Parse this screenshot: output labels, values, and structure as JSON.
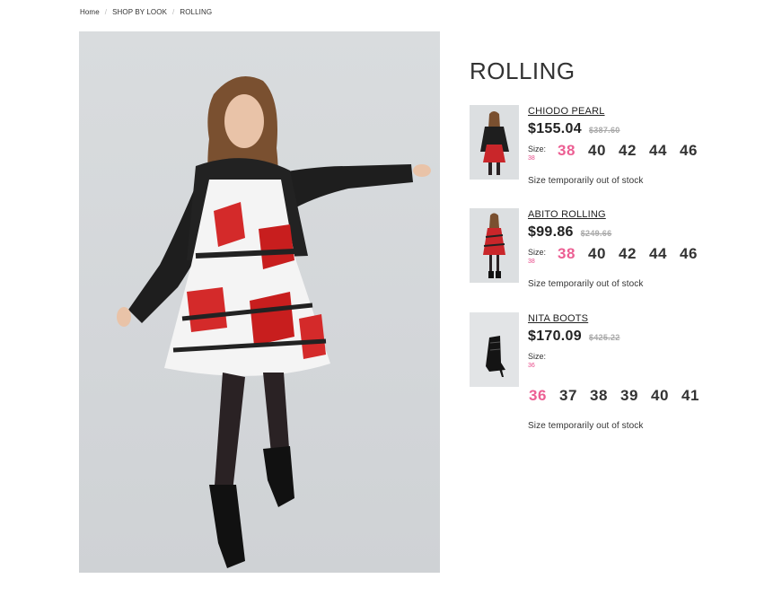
{
  "breadcrumb": {
    "home": "Home",
    "section": "SHOP BY LOOK",
    "current": "ROLLING"
  },
  "look": {
    "title": "ROLLING"
  },
  "products": [
    {
      "name": "CHIODO PEARL",
      "price": "$155.04",
      "old_price": "$387.60",
      "size_label": "Size:",
      "selected_size": "38",
      "sizes": [
        "38",
        "40",
        "42",
        "44",
        "46"
      ],
      "stock": "Size temporarily out of stock"
    },
    {
      "name": "ABITO ROLLING",
      "price": "$99.86",
      "old_price": "$249.66",
      "size_label": "Size:",
      "selected_size": "38",
      "sizes": [
        "38",
        "40",
        "42",
        "44",
        "46"
      ],
      "stock": "Size temporarily out of stock"
    },
    {
      "name": "NITA BOOTS",
      "price": "$170.09",
      "old_price": "$425.22",
      "size_label": "Size:",
      "selected_size": "36",
      "sizes": [
        "36",
        "37",
        "38",
        "39",
        "40",
        "41"
      ],
      "stock": "Size temporarily out of stock"
    }
  ],
  "colors": {
    "accent_pink": "#ec5f93",
    "text": "#222222",
    "muted": "#aaaaaa"
  }
}
